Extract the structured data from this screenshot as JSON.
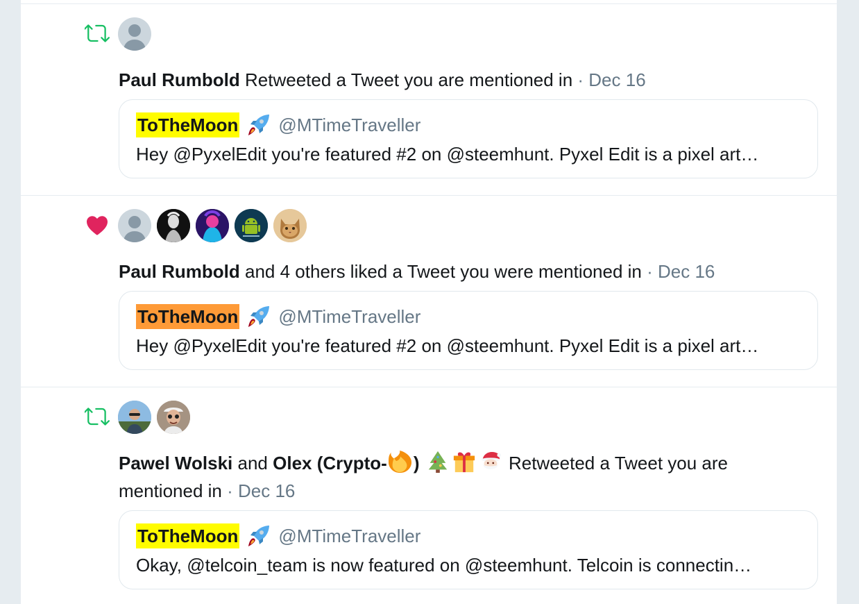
{
  "notifications": [
    {
      "type": "retweet",
      "icon": "retweet-icon",
      "avatars": [
        "default-avatar"
      ],
      "actors": [
        "Paul Rumbold"
      ],
      "connector": "",
      "action": "Retweeted a Tweet you are mentioned in",
      "separator": " · ",
      "date": "Dec 16",
      "quote": {
        "name": "ToTheMoon",
        "name_highlight": "#fffc00",
        "handle": "@MTimeTraveller",
        "text": "Hey @PyxelEdit you're featured #2 on @steemhunt. Pyxel Edit is a pixel art…"
      }
    },
    {
      "type": "like",
      "icon": "heart-icon",
      "avatars": [
        "default-avatar",
        "user-avatar-2",
        "user-avatar-3",
        "user-avatar-android",
        "user-avatar-cat"
      ],
      "actors": [
        "Paul Rumbold"
      ],
      "connector": "",
      "action": "and 4 others liked a Tweet you were mentioned in",
      "separator": " · ",
      "date": "Dec 16",
      "quote": {
        "name": "ToTheMoon",
        "name_highlight": "#fe9a37",
        "handle": "@MTimeTraveller",
        "text": "Hey @PyxelEdit you're featured #2 on @steemhunt. Pyxel Edit is a pixel art…"
      }
    },
    {
      "type": "retweet",
      "icon": "retweet-icon",
      "avatars": [
        "user-avatar-pawel",
        "user-avatar-olex"
      ],
      "actors": [
        "Pawel Wolski",
        "Olex (Crypto-"
      ],
      "actor2_suffix": ")",
      "connector": "and",
      "action": "Retweeted a Tweet you are",
      "action_line2": "mentioned in",
      "separator": " · ",
      "date": "Dec 16",
      "quote": {
        "name": "ToTheMoon",
        "name_highlight": "#fffc00",
        "handle": "@MTimeTraveller",
        "text": "Okay, @telcoin_team is now featured on @steemhunt. Telcoin is connectin…"
      }
    }
  ],
  "colors": {
    "retweet": "#17bf63",
    "like": "#e0245e",
    "secondary_text": "#657786",
    "border": "#e6ecf0",
    "page_bg": "#e6ecf0"
  }
}
